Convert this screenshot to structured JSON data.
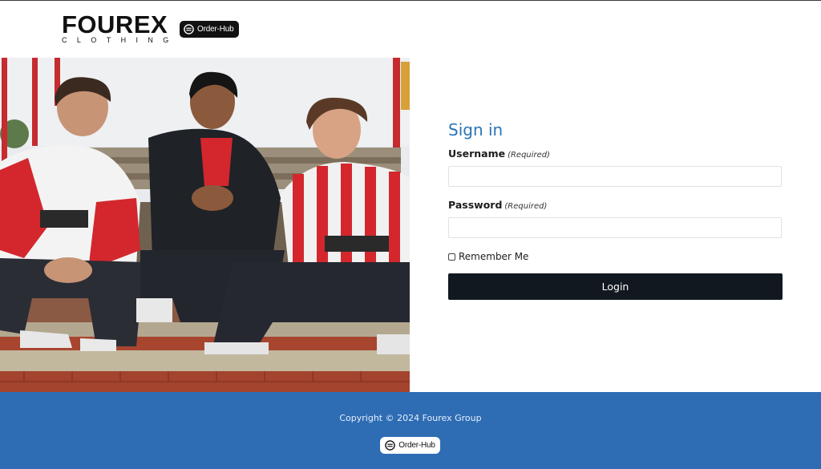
{
  "header": {
    "brand_name": "FOUREX",
    "brand_sub": "CLOTHING",
    "badge_label": "Order-Hub"
  },
  "hero": {
    "image_description": ""
  },
  "signin": {
    "title": "Sign in",
    "username_label": "Username",
    "username_required": "(Required)",
    "username_value": "",
    "password_label": "Password",
    "password_required": "(Required)",
    "password_value": "",
    "remember_label": "Remember Me",
    "login_label": "Login"
  },
  "footer": {
    "copyright": "Copyright © 2024 Fourex Group",
    "badge_label": "Order-Hub"
  },
  "colors": {
    "accent": "#2a74b8",
    "footer_bg": "#2e6db4",
    "button_bg": "#111820"
  }
}
